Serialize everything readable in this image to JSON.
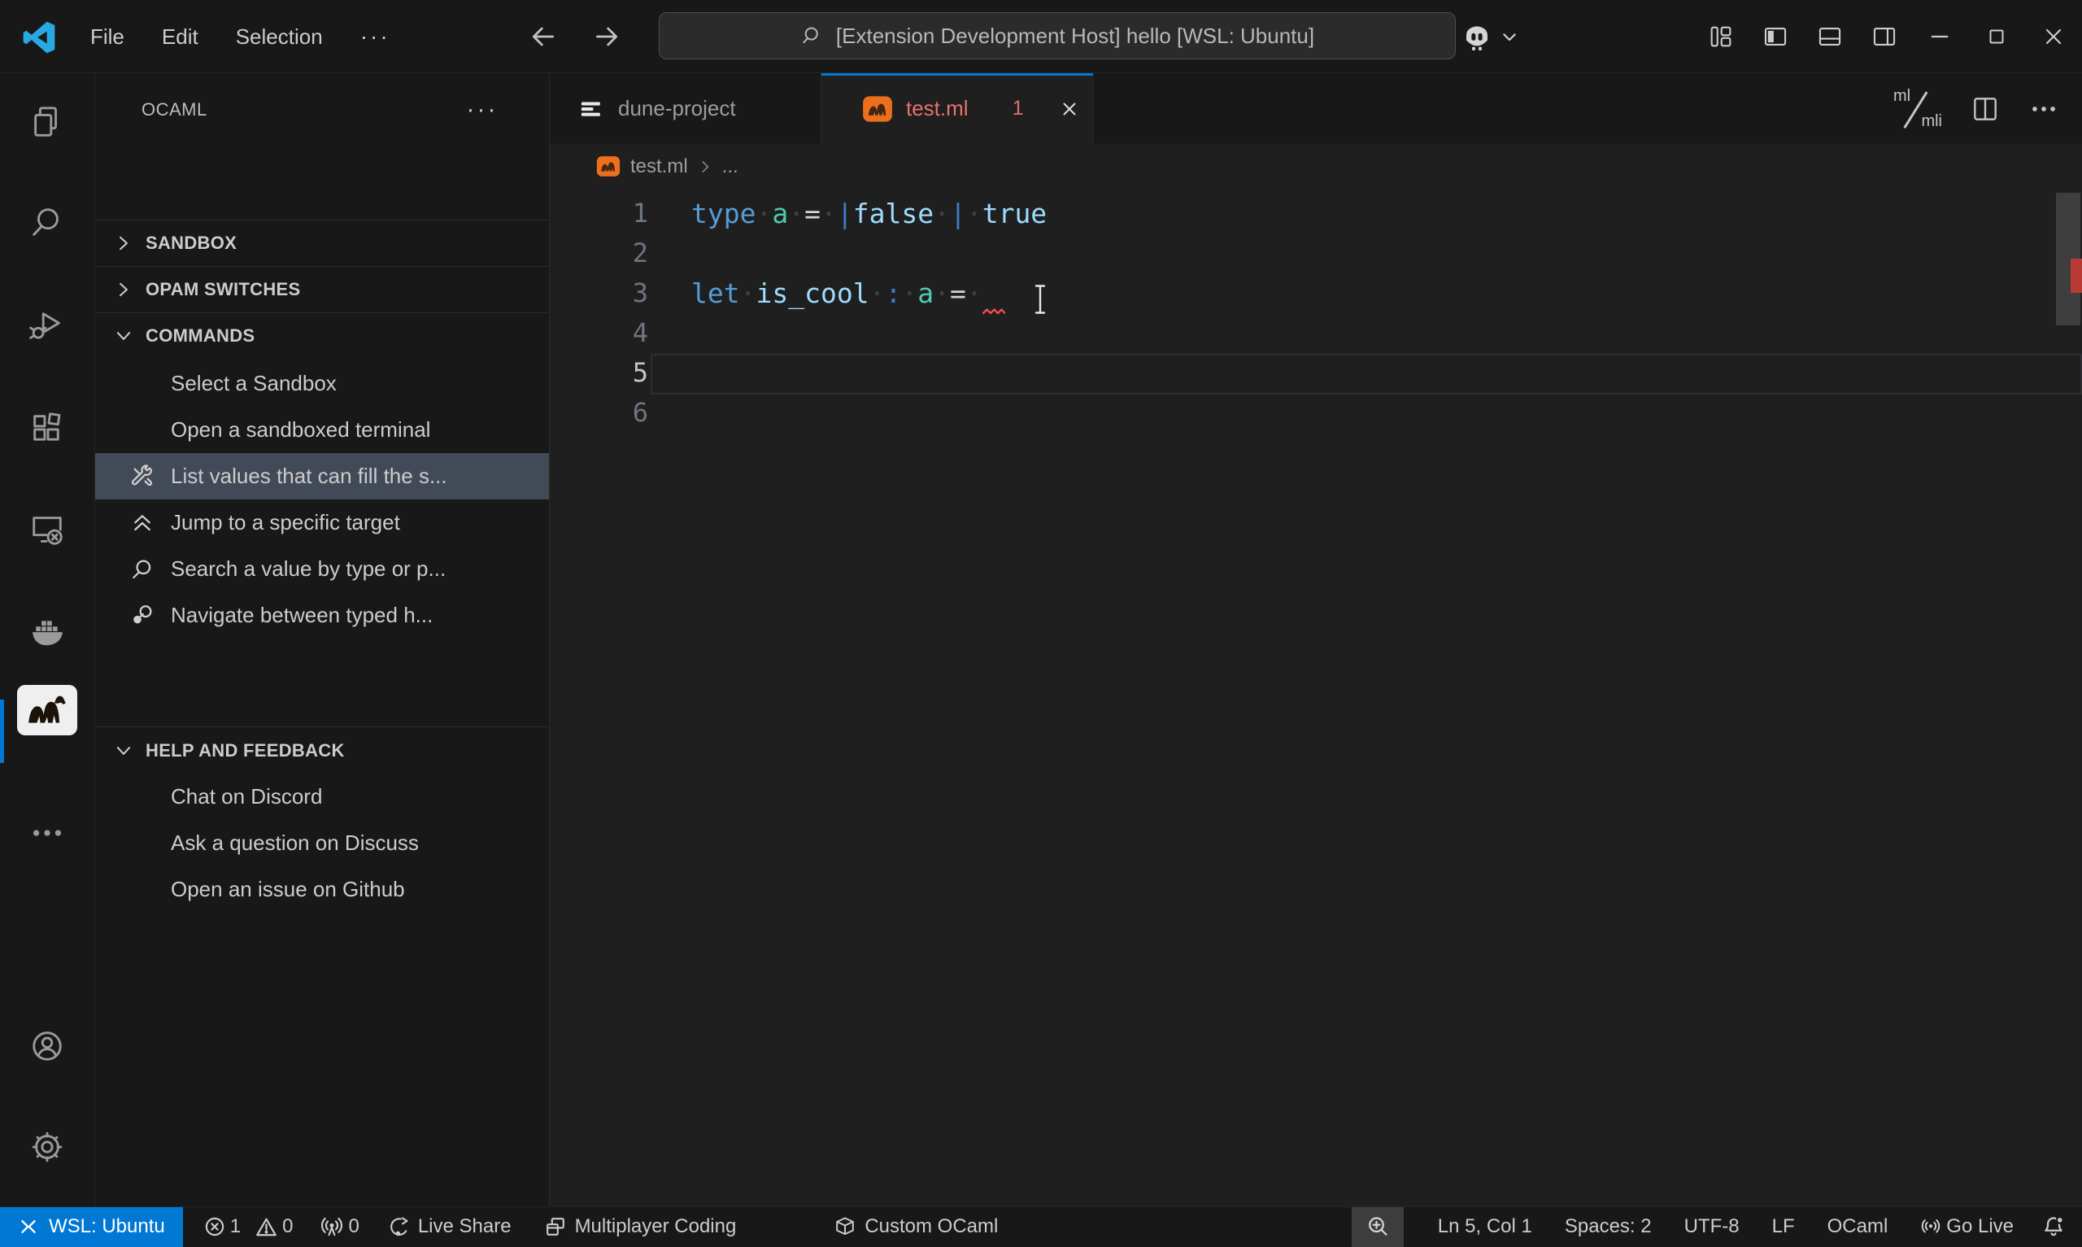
{
  "colors": {
    "accent": "#0078d4",
    "error": "#f14c4c",
    "remote_badge_bg": "#0078d4",
    "tab_problem_fg": "#e5726c",
    "editor_bg": "#1f1f1f",
    "shell_bg": "#181818",
    "selected_row_bg": "#434a57",
    "camel_icon_orange": "#ec6f1d"
  },
  "titlebar": {
    "menus": [
      "File",
      "Edit",
      "Selection"
    ],
    "command_center": "[Extension Development Host] hello [WSL: Ubuntu]"
  },
  "activitybar": {
    "items": [
      "explorer",
      "search",
      "run-and-debug",
      "extensions",
      "remote-explorer",
      "docker",
      "ocaml-platform",
      "more"
    ],
    "bottom_items": [
      "accounts",
      "settings"
    ],
    "active": "ocaml-platform"
  },
  "sidebar": {
    "title": "OCAML",
    "more_label": "···",
    "sections": [
      {
        "label": "SANDBOX",
        "collapsed": true
      },
      {
        "label": "OPAM SWITCHES",
        "collapsed": true
      },
      {
        "label": "COMMANDS",
        "collapsed": false,
        "items": [
          {
            "label": "Select a Sandbox"
          },
          {
            "label": "Open a sandboxed terminal"
          },
          {
            "label": "List values that can fill the s...",
            "icon": "tools",
            "selected": true
          },
          {
            "label": "Jump to a specific target",
            "icon": "double-chevron-up"
          },
          {
            "label": "Search a value by type or p...",
            "icon": "search"
          },
          {
            "label": "Navigate between typed h...",
            "icon": "key"
          }
        ]
      },
      {
        "label": "HELP AND FEEDBACK",
        "collapsed": false,
        "items": [
          {
            "label": "Chat on Discord"
          },
          {
            "label": "Ask a question on Discuss"
          },
          {
            "label": "Open an issue on Github"
          }
        ]
      }
    ]
  },
  "editor": {
    "tabs": [
      {
        "label": "dune-project",
        "active": false
      },
      {
        "label": "test.ml",
        "active": true,
        "problems": "1"
      }
    ],
    "actions": {
      "impl_intf_top": "ml",
      "impl_intf_bottom": "mli"
    },
    "breadcrumb": {
      "file": "test.ml",
      "more": "..."
    },
    "code": {
      "palette": {
        "kw": "#569cd6",
        "id": "#9cdcfe",
        "ty": "#4ec9b0",
        "op": "#d4d4d4",
        "pu": "#3d7cc9",
        "ws": "#3e4043"
      },
      "lines": [
        {
          "n": "1",
          "tokens": [
            [
              "type",
              "kw"
            ],
            [
              "·",
              "ws"
            ],
            [
              "a",
              "ty"
            ],
            [
              "·",
              "ws"
            ],
            [
              "=",
              "op"
            ],
            [
              "·",
              "ws"
            ],
            [
              "|",
              "pu"
            ],
            [
              "false",
              "id"
            ],
            [
              "·",
              "ws"
            ],
            [
              "|",
              "pu"
            ],
            [
              "·",
              "ws"
            ],
            [
              "true",
              "id"
            ]
          ]
        },
        {
          "n": "2",
          "tokens": []
        },
        {
          "n": "3",
          "tokens": [
            [
              "let",
              "kw"
            ],
            [
              "·",
              "ws"
            ],
            [
              "is_cool",
              "id"
            ],
            [
              "·",
              "ws"
            ],
            [
              ":",
              "pu"
            ],
            [
              "·",
              "ws"
            ],
            [
              "a",
              "ty"
            ],
            [
              "·",
              "ws"
            ],
            [
              "=",
              "op"
            ],
            [
              "·",
              "ws"
            ]
          ]
        },
        {
          "n": "4",
          "tokens": []
        },
        {
          "n": "5",
          "tokens": [],
          "active": true
        },
        {
          "n": "6",
          "tokens": []
        }
      ],
      "plain_text": [
        "type a = |false | true",
        "",
        "let is_cool : a =",
        "",
        "",
        ""
      ]
    }
  },
  "statusbar": {
    "remote": "WSL: Ubuntu",
    "errors": "1",
    "warnings": "0",
    "ports": "0",
    "live_share": "Live Share",
    "multiplayer": "Multiplayer Coding",
    "custom_ocaml": "Custom OCaml",
    "cursor": "Ln 5, Col 1",
    "indentation": "Spaces: 2",
    "encoding": "UTF-8",
    "eol": "LF",
    "language": "OCaml",
    "go_live": "Go Live"
  }
}
